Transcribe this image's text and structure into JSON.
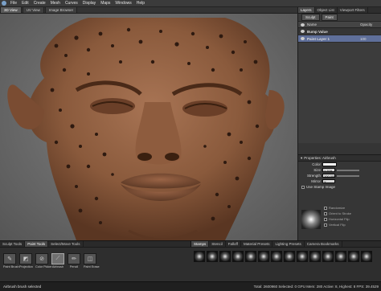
{
  "menu": [
    "File",
    "Edit",
    "Create",
    "Mesh",
    "Curves",
    "Display",
    "Maps",
    "Windows",
    "Help"
  ],
  "view_tabs": [
    "3D View",
    "UV View",
    "Image Browser"
  ],
  "right_tabs": [
    "Layers",
    "Object List",
    "Viewport Filters"
  ],
  "layer_buttons": {
    "sculpt": "Sculpt",
    "paint": "Paint"
  },
  "layer_columns": {
    "name": "Name",
    "opacity": "Opacity"
  },
  "layers": [
    {
      "name": "Bump Value",
      "opacity": ""
    },
    {
      "name": "Paint Layer 1",
      "opacity": "100"
    }
  ],
  "properties": {
    "title": "Properties: Airbrush",
    "color_label": "Color",
    "color": "#ffffff",
    "size_label": "Size",
    "size_value": "1.378",
    "strength_label": "Strength",
    "strength_value": "100.000",
    "mirror_label": "Mirror",
    "mirror_value": "X",
    "use_stamp_label": "Use Stamp Image",
    "options": [
      "Randomize",
      "Orient to Stroke",
      "Horizontal Flip",
      "Vertical Flip"
    ]
  },
  "bottom_left_tabs": [
    "Sculpt Tools",
    "Paint Tools",
    "Select/Move Tools"
  ],
  "tools": [
    {
      "label": "Paint Brush",
      "icon": "brush-icon"
    },
    {
      "label": "Projection",
      "icon": "projection-icon"
    },
    {
      "label": "Color Picker",
      "icon": "color-picker-icon"
    },
    {
      "label": "Airbrush",
      "icon": "airbrush-icon"
    },
    {
      "label": "Pencil",
      "icon": "pencil-icon"
    },
    {
      "label": "Paint Erase",
      "icon": "erase-icon"
    }
  ],
  "bottom_right_tabs": [
    "Stamps",
    "Stencil",
    "Falloff",
    "Material Presets",
    "Lighting Presets",
    "Camera Bookmarks"
  ],
  "stamp_count": 14,
  "status": {
    "left": "Airbrush brush selected",
    "right": "Total: 2600960  Selected: 0  GPU Mem: 280  Active: 8, Highest: 8  FPS: 39.4529"
  },
  "colors": {
    "skin": "#8a5a3c",
    "accent": "#5f6f9a"
  }
}
